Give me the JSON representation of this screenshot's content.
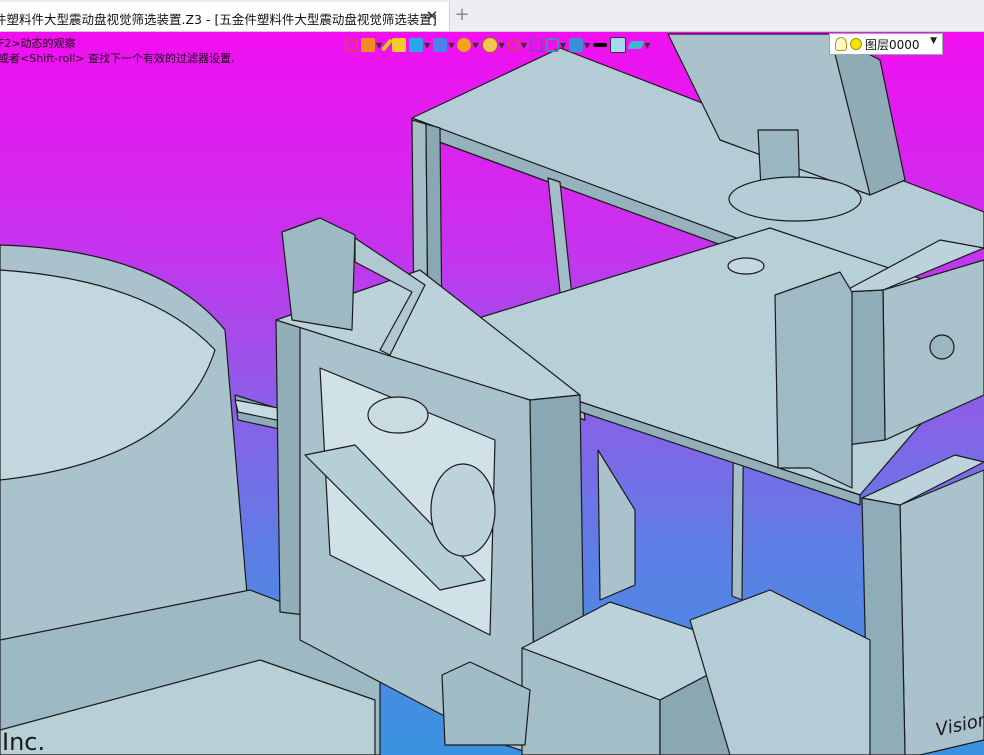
{
  "tab": {
    "title": "件塑料件大型震动盘视觉筛选装置.Z3 - [五金件塑料件大型震动盘视觉筛选装置]",
    "close_glyph": "✕",
    "add_glyph": "+"
  },
  "viewport": {
    "hint_line1": "F2>动态的观察",
    "hint_line2": "或者<Shift-roll> 查找下一个有效的过滤器设置.",
    "corner_text": "Inc.",
    "model_label": "Vision"
  },
  "toolbar": {
    "icons": [
      "exit-sketch-icon",
      "pick-filter-icon",
      "pencil-icon",
      "cube-yellow-icon",
      "cube-blue-icon",
      "view-cube-icon",
      "display-mode-icon",
      "shading-icon",
      "snap-icon",
      "target-icon",
      "frame-icon",
      "camera-icon",
      "line-color-icon",
      "fill-color-icon",
      "layer-stack-icon"
    ],
    "layer_name": "图层0000"
  },
  "colors": {
    "background_top": "#f10ff0",
    "background_bottom": "#3a93e0",
    "model_face": "#a9c2cc",
    "model_edge": "#1a1a1a"
  }
}
